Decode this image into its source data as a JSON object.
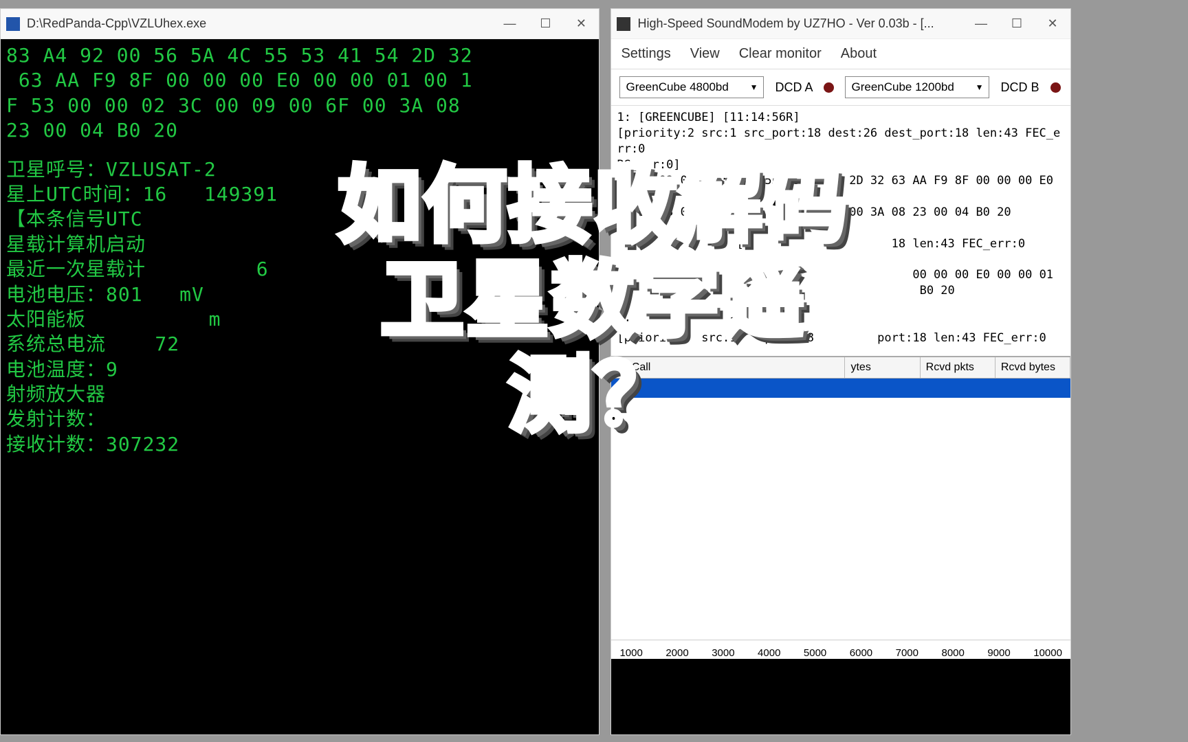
{
  "left": {
    "title": "D:\\RedPanda-Cpp\\VZLUhex.exe",
    "hex_block": "83 A4 92 00 56 5A 4C 55 53 41 54 2D 32\n 63 AA F9 8F 00 00 00 E0 00 00 01 00 1\nF 53 00 00 02 3C 00 09 00 6F 00 3A 08\n23 00 04 B0 20\n",
    "decoded": [
      "卫星呼号：VZLUSAT-2",
      "星上UTC时间：16   149391",
      "【本条信号UTC",
      "星载计算机启动",
      "最近一次星载计         6",
      "电池电压：801   mV",
      "太阳能板          m",
      "系统总电流    72",
      "电池温度：9",
      "射频放大器",
      "发射计数：",
      "接收计数：307232"
    ]
  },
  "right": {
    "title": "High-Speed SoundModem by UZ7HO - Ver 0.03b - [...",
    "menu": {
      "settings": "Settings",
      "view": "View",
      "clear": "Clear monitor",
      "about": "About"
    },
    "modeA": "GreenCube 4800bd",
    "dcdA": "DCD A",
    "modeB": "GreenCube 1200bd",
    "dcdB": "DCD B",
    "log": "1: [GREENCUBE] [11:14:56R]\n[priority:2 src:1 src_port:18 dest:26 dest_port:18 len:43 FEC_err:0\nRS_err:0]\nS3 A4 92 00 56 5A 4C 55 53 41 54 2D 32 63 AA F9 8F 00 00 00 E0 00 00 01\n00 1F 53 00 00 02 3C 00 09 00 6F 00 3A 08 23 00 04 B0 20\n\n                 [1                    18 len:43 FEC_err:0\n\n                   5A                     00 00 00 E0 00 00 01\n                                           B0 20\n\n1:              15\n[priority   src:1    port:18         port:18 len:43 FEC_err:0\n\n                                           00 00 00 E0 00 00 01\n                                           B0 20",
    "table": {
      "col1": "MyCall",
      "col2": "ytes",
      "col3": "Rcvd pkts",
      "col4": "Rcvd bytes"
    },
    "ticks": [
      "1000",
      "2000",
      "3000",
      "4000",
      "5000",
      "6000",
      "7000",
      "8000",
      "9000",
      "10000"
    ]
  },
  "overlay": {
    "line1": "如何接收解码",
    "line2": "卫星数字遥测？"
  }
}
